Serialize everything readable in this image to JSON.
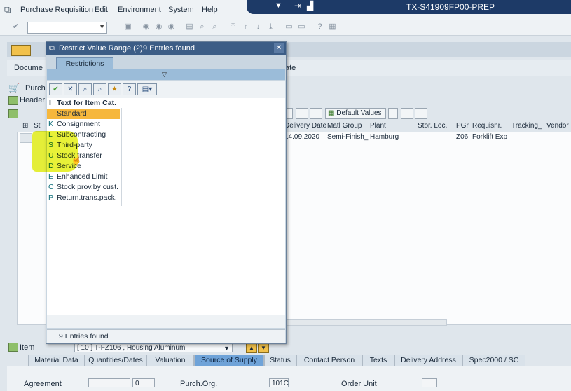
{
  "menu": {
    "items": [
      "Purchase Requisition",
      "Edit",
      "Environment",
      "System",
      "Help"
    ]
  },
  "system": {
    "id": "TX-S41909FP00-PREP"
  },
  "background": {
    "tab_document": "Docume",
    "tab_date": "ate",
    "purchase_label": "Purcha",
    "header_label": "Header",
    "default_values": "Default Values",
    "grid_headers": [
      "St",
      "Delivery Date",
      "Matl Group",
      "Plant",
      "Stor. Loc.",
      "PGr",
      "Requisnr.",
      "Tracking_",
      "Vendor"
    ],
    "grid_row": {
      "delivery_date": "14.09.2020",
      "matl_group": "Semi-Finish_",
      "plant": "Hamburg",
      "pgr": "Z06",
      "requisnr": "Forklift Exp"
    }
  },
  "item_bar": {
    "label": "Item",
    "selection": "[ 10 ] T-FZ106 , Housing Aluminum"
  },
  "bottom_tabs": [
    {
      "label": "Material Data",
      "active": false
    },
    {
      "label": "Quantities/Dates",
      "active": false
    },
    {
      "label": "Valuation",
      "active": false
    },
    {
      "label": "Source of Supply",
      "active": true
    },
    {
      "label": "Status",
      "active": false
    },
    {
      "label": "Contact Person",
      "active": false
    },
    {
      "label": "Texts",
      "active": false
    },
    {
      "label": "Delivery Address",
      "active": false
    },
    {
      "label": "Spec2000 / SC",
      "active": false
    }
  ],
  "bottom_fields": {
    "agreement_label": "Agreement",
    "agreement_item": "0",
    "purch_org_label": "Purch.Org.",
    "purch_org_value": "101C",
    "order_unit_label": "Order Unit"
  },
  "popup": {
    "title": "Restrict Value Range (2)",
    "entries_found": "9 Entries found",
    "tab": "Restrictions",
    "column_key": "I",
    "column_header": "Text for Item Cat.",
    "rows": [
      {
        "key": "",
        "text": "Standard"
      },
      {
        "key": "K",
        "text": "Consignment"
      },
      {
        "key": "L",
        "text": "Subcontracting"
      },
      {
        "key": "S",
        "text": "Third-party"
      },
      {
        "key": "U",
        "text": "Stock transfer"
      },
      {
        "key": "D",
        "text": "Service"
      },
      {
        "key": "E",
        "text": "Enhanced Limit"
      },
      {
        "key": "C",
        "text": "Stock prov.by cust."
      },
      {
        "key": "P",
        "text": "Return.trans.pack."
      }
    ],
    "status": "9 Entries found"
  },
  "colors": {
    "titlebar": "#1d3a67",
    "selected_row": "#f6b73c",
    "highlight": "#e4ef15"
  }
}
